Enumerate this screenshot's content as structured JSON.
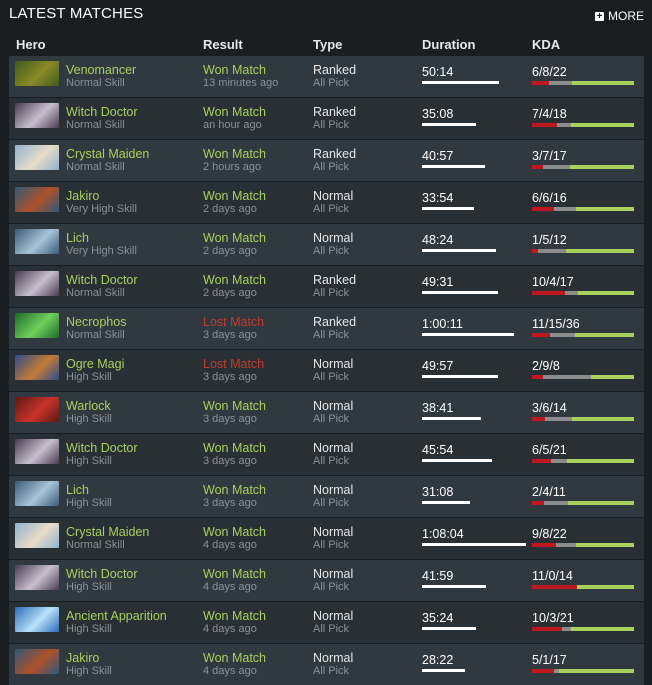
{
  "header": {
    "title": "LATEST MATCHES",
    "more_label": "MORE"
  },
  "columns": {
    "hero": "Hero",
    "result": "Result",
    "type": "Type",
    "duration": "Duration",
    "kda": "KDA"
  },
  "colors": {
    "won": "#a7d15c",
    "lost": "#c23c2a",
    "kills": "#c0181c",
    "deaths": "#8c8c8c",
    "assists": "#a7d15c"
  },
  "matches": [
    {
      "hero": "Venomancer",
      "skill": "Normal Skill",
      "result": "Won Match",
      "outcome": "won",
      "when": "13 minutes ago",
      "type": "Ranked",
      "mode": "All Pick",
      "duration": "50:14",
      "duration_min": 50.23,
      "kda": "6/8/22",
      "k": 6,
      "d": 8,
      "a": 22,
      "portrait": [
        "#3f5a1c",
        "#8a8a28"
      ]
    },
    {
      "hero": "Witch Doctor",
      "skill": "Normal Skill",
      "result": "Won Match",
      "outcome": "won",
      "when": "an hour ago",
      "type": "Ranked",
      "mode": "All Pick",
      "duration": "35:08",
      "duration_min": 35.13,
      "kda": "7/4/18",
      "k": 7,
      "d": 4,
      "a": 18,
      "portrait": [
        "#4a3a52",
        "#c8c0cc"
      ]
    },
    {
      "hero": "Crystal Maiden",
      "skill": "Normal Skill",
      "result": "Won Match",
      "outcome": "won",
      "when": "2 hours ago",
      "type": "Ranked",
      "mode": "All Pick",
      "duration": "40:57",
      "duration_min": 40.95,
      "kda": "3/7/17",
      "k": 3,
      "d": 7,
      "a": 17,
      "portrait": [
        "#8fb2cf",
        "#e8dcc8"
      ]
    },
    {
      "hero": "Jakiro",
      "skill": "Very High Skill",
      "result": "Won Match",
      "outcome": "won",
      "when": "2 days ago",
      "type": "Normal",
      "mode": "All Pick",
      "duration": "33:54",
      "duration_min": 33.9,
      "kda": "6/6/16",
      "k": 6,
      "d": 6,
      "a": 16,
      "portrait": [
        "#2c5a7a",
        "#b0502a"
      ]
    },
    {
      "hero": "Lich",
      "skill": "Very High Skill",
      "result": "Won Match",
      "outcome": "won",
      "when": "2 days ago",
      "type": "Normal",
      "mode": "All Pick",
      "duration": "48:24",
      "duration_min": 48.4,
      "kda": "1/5/12",
      "k": 1,
      "d": 5,
      "a": 12,
      "portrait": [
        "#3a5a78",
        "#a8c4d8"
      ]
    },
    {
      "hero": "Witch Doctor",
      "skill": "Normal Skill",
      "result": "Won Match",
      "outcome": "won",
      "when": "2 days ago",
      "type": "Ranked",
      "mode": "All Pick",
      "duration": "49:31",
      "duration_min": 49.52,
      "kda": "10/4/17",
      "k": 10,
      "d": 4,
      "a": 17,
      "portrait": [
        "#4a3a52",
        "#c8c0cc"
      ]
    },
    {
      "hero": "Necrophos",
      "skill": "Normal Skill",
      "result": "Lost Match",
      "outcome": "lost",
      "when": "3 days ago",
      "type": "Ranked",
      "mode": "All Pick",
      "duration": "1:00:11",
      "duration_min": 60.18,
      "kda": "11/15/36",
      "k": 11,
      "d": 15,
      "a": 36,
      "portrait": [
        "#1e6a2a",
        "#6fd05a"
      ]
    },
    {
      "hero": "Ogre Magi",
      "skill": "High Skill",
      "result": "Lost Match",
      "outcome": "lost",
      "when": "3 days ago",
      "type": "Normal",
      "mode": "All Pick",
      "duration": "49:57",
      "duration_min": 49.95,
      "kda": "2/9/8",
      "k": 2,
      "d": 9,
      "a": 8,
      "portrait": [
        "#2a4e8a",
        "#c47a38"
      ]
    },
    {
      "hero": "Warlock",
      "skill": "High Skill",
      "result": "Won Match",
      "outcome": "won",
      "when": "3 days ago",
      "type": "Normal",
      "mode": "All Pick",
      "duration": "38:41",
      "duration_min": 38.68,
      "kda": "3/6/14",
      "k": 3,
      "d": 6,
      "a": 14,
      "portrait": [
        "#5a1a14",
        "#c8322a"
      ]
    },
    {
      "hero": "Witch Doctor",
      "skill": "High Skill",
      "result": "Won Match",
      "outcome": "won",
      "when": "3 days ago",
      "type": "Normal",
      "mode": "All Pick",
      "duration": "45:54",
      "duration_min": 45.9,
      "kda": "6/5/21",
      "k": 6,
      "d": 5,
      "a": 21,
      "portrait": [
        "#4a3a52",
        "#c8c0cc"
      ]
    },
    {
      "hero": "Lich",
      "skill": "High Skill",
      "result": "Won Match",
      "outcome": "won",
      "when": "3 days ago",
      "type": "Normal",
      "mode": "All Pick",
      "duration": "31:08",
      "duration_min": 31.13,
      "kda": "2/4/11",
      "k": 2,
      "d": 4,
      "a": 11,
      "portrait": [
        "#3a5a78",
        "#a8c4d8"
      ]
    },
    {
      "hero": "Crystal Maiden",
      "skill": "Normal Skill",
      "result": "Won Match",
      "outcome": "won",
      "when": "4 days ago",
      "type": "Normal",
      "mode": "All Pick",
      "duration": "1:08:04",
      "duration_min": 68.07,
      "kda": "9/8/22",
      "k": 9,
      "d": 8,
      "a": 22,
      "portrait": [
        "#8fb2cf",
        "#e8dcc8"
      ]
    },
    {
      "hero": "Witch Doctor",
      "skill": "High Skill",
      "result": "Won Match",
      "outcome": "won",
      "when": "4 days ago",
      "type": "Normal",
      "mode": "All Pick",
      "duration": "41:59",
      "duration_min": 41.98,
      "kda": "11/0/14",
      "k": 11,
      "d": 0,
      "a": 14,
      "portrait": [
        "#4a3a52",
        "#c8c0cc"
      ]
    },
    {
      "hero": "Ancient Apparition",
      "skill": "High Skill",
      "result": "Won Match",
      "outcome": "won",
      "when": "4 days ago",
      "type": "Normal",
      "mode": "All Pick",
      "duration": "35:24",
      "duration_min": 35.4,
      "kda": "10/3/21",
      "k": 10,
      "d": 3,
      "a": 21,
      "portrait": [
        "#2a6ab8",
        "#b8e2f8"
      ]
    },
    {
      "hero": "Jakiro",
      "skill": "High Skill",
      "result": "Won Match",
      "outcome": "won",
      "when": "4 days ago",
      "type": "Normal",
      "mode": "All Pick",
      "duration": "28:22",
      "duration_min": 28.37,
      "kda": "5/1/17",
      "k": 5,
      "d": 1,
      "a": 17,
      "portrait": [
        "#2c5a7a",
        "#b0502a"
      ]
    }
  ]
}
